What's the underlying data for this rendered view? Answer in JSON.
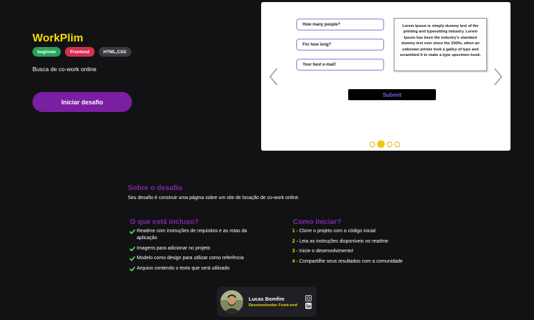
{
  "hero": {
    "title": "WorkPlim",
    "tags": [
      "beginner",
      "Frontend",
      "HTML,CSS"
    ],
    "subtitle": "Busca de co-work online",
    "start_button": "Iniciar desafio"
  },
  "carousel": {
    "fields": [
      "How many people?",
      "For how long?",
      "Your best e-mail!"
    ],
    "lorem": "Lorem Ipsum is simply dummy text of the printing and typesetting industry. Lorem Ipsum has been the industry's standard dummy text ever since the 1500s, when an unknown printer took a galley of type and scrambled it to make a type specimen book.",
    "submit": "Submit",
    "active_slide": 2,
    "slide_count": 4
  },
  "about": {
    "title": "Sobre o desafio",
    "text": "Seu desafio é construir uma página sobre um site de locação de co-work online."
  },
  "included": {
    "title": "O que está incluso?",
    "items": [
      "Readme com instruções de requisitos e as rotas da aplicação",
      "Imagens para adicionar no projeto",
      "Modelo como design para utilizar como referência",
      "Arquivo contendo o texto que será utilizado"
    ]
  },
  "how_to_start": {
    "title": "Como iniciar?",
    "steps": [
      {
        "num": "1 -",
        "text": "Clone o projeto com o código inicial"
      },
      {
        "num": "2 -",
        "text": "Leia as instruções disponíveis no readme"
      },
      {
        "num": "3 -",
        "text": "Inicie o desenvolvimento!"
      },
      {
        "num": "4 -",
        "text": "Compartilhe seus resultados com a comunidade"
      }
    ]
  },
  "author": {
    "name": "Lucas Bomfim",
    "role": "Desenvolvedor Front-end"
  },
  "colors": {
    "background": "#121214",
    "accent_yellow": "#f5d90a",
    "accent_purple": "#7a1fa2",
    "check_green": "#5ee64a"
  }
}
